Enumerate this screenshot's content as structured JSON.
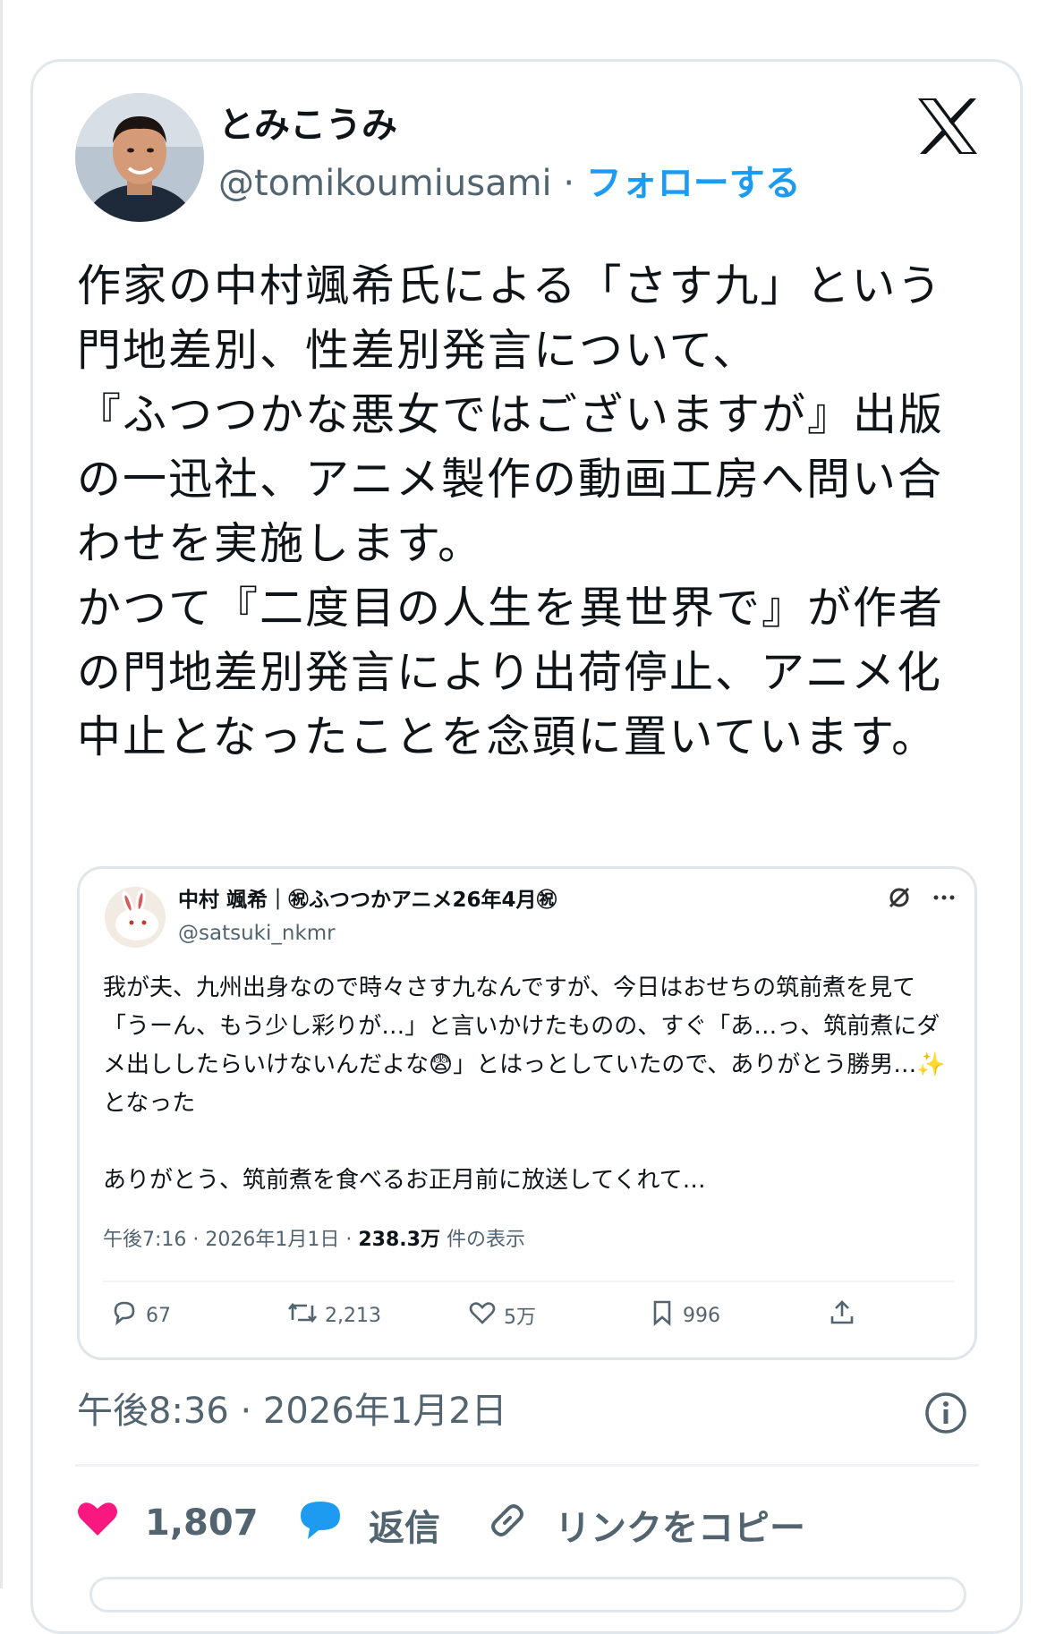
{
  "author": {
    "name": "とみこうみ",
    "handle": "@tomikoumiusami",
    "separator": " · ",
    "follow_label": "フォローする"
  },
  "body_text": "作家の中村颯希氏による「さす九」という門地差別、性差別発言について、\n『ふつつかな悪女ではございますが』出版の一迅社、アニメ製作の動画工房へ問い合わせを実施します。\nかつて『二度目の人生を異世界で』が作者の門地差別発言により出荷停止、アニメ化中止となったことを念頭に置いています。",
  "quoted": {
    "name": "中村 颯希｜㊗ふつつかアニメ26年4月㊗",
    "handle": "@satsuki_nkmr",
    "text": "我が夫、九州出身なので時々さす九なんですが、今日はおせちの筑前煮を見て「うーん、もう少し彩りが…」と言いかけたものの、すぐ「あ…っ、筑前煮にダメ出ししたらいけないんだよな😨」とはっとしていたので、ありがとう勝男…✨となった\n\nありがとう、筑前煮を食べるお正月前に放送してくれて…",
    "timestamp": "午後7:16 · 2026年1月1日 · ",
    "views": "238.3万",
    "views_suffix": " 件の表示",
    "replies": "67",
    "retweets": "2,213",
    "likes": "5万",
    "bookmarks": "996"
  },
  "timestamp": "午後8:36 · 2026年1月2日",
  "actions": {
    "likes": "1,807",
    "reply_label": "返信",
    "copy_link_label": "リンクをコピー"
  },
  "colors": {
    "accent": "#1d9bf0",
    "like": "#f91880",
    "text": "#0f1419",
    "muted": "#536471"
  }
}
